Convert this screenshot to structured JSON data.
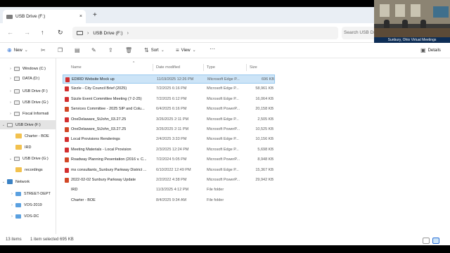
{
  "tab": {
    "title": "USB Drive (F:)",
    "close": "×",
    "new": "+"
  },
  "nav_glyphs": {
    "back": "←",
    "forward": "→",
    "up": "↑",
    "refresh": "↻",
    "more": "···",
    "chevron_right": "›"
  },
  "address": {
    "crumb": "USB Drive (F:)",
    "sep": "›",
    "search_placeholder": "Search USB Dr"
  },
  "toolbar": {
    "new": "New",
    "new_chev": "⌄",
    "sort": "Sort",
    "sort_chev": "⌄",
    "view": "View",
    "view_chev": "⌄",
    "more": "···",
    "details": "Details"
  },
  "sidebar": {
    "items": [
      {
        "label": "Windows (C:)",
        "chev": "›",
        "icon": "drive-icon"
      },
      {
        "label": "DATA (D:)",
        "chev": "›",
        "icon": "drive-icon"
      },
      {
        "label": "USB Drive (F:)",
        "chev": "›",
        "icon": "drive-icon"
      },
      {
        "label": "USB Drive (G:)",
        "chev": "›",
        "icon": "drive-icon"
      },
      {
        "label": "Fiscal Informati",
        "chev": "›",
        "icon": "drive-icon"
      },
      {
        "label": "USB Drive (F:)",
        "chev": "⌄",
        "icon": "drive-icon"
      },
      {
        "label": "Charter - BOE",
        "chev": "",
        "icon": "folder-icon"
      },
      {
        "label": "IRD",
        "chev": "",
        "icon": "folder-icon"
      },
      {
        "label": "USB Drive (G:)",
        "chev": "⌄",
        "icon": "drive-icon"
      },
      {
        "label": "recordings",
        "chev": "",
        "icon": "folder-icon"
      },
      {
        "label": "Network",
        "chev": "⌄",
        "icon": "network-icon"
      },
      {
        "label": "STREET-DEPT",
        "chev": "›",
        "icon": "computer-icon"
      },
      {
        "label": "VOS-2019",
        "chev": "›",
        "icon": "computer-icon"
      },
      {
        "label": "VOS-DC",
        "chev": "›",
        "icon": "computer-icon"
      }
    ]
  },
  "columns": {
    "name": "Name",
    "date": "Date modified",
    "type": "Type",
    "size": "Size",
    "sort_glyph": "^"
  },
  "files": [
    {
      "name": "EDIRD Website Mock up",
      "date": "11/19/2025 12:26 PM",
      "type": "Microsoft Edge P...",
      "size": "696 KB",
      "kind": "pdf"
    },
    {
      "name": "Sizzle - City Council Brief (2025)",
      "date": "7/2/2025 6:16 PM",
      "type": "Microsoft Edge P...",
      "size": "58,961 KB",
      "kind": "pdf"
    },
    {
      "name": "Sizzle Event Committee Meeting (7-2-25)",
      "date": "7/2/2025 6:12 PM",
      "type": "Microsoft Edge P...",
      "size": "16,064 KB",
      "kind": "pdf"
    },
    {
      "name": "Services Committee - 2025 SIP and Colu...",
      "date": "6/4/2025 6:16 PM",
      "type": "Microsoft PowerP...",
      "size": "20,158 KB",
      "kind": "ppt"
    },
    {
      "name": "OneDelaware_StJohn_03.27.25",
      "date": "3/26/2025 2:11 PM",
      "type": "Microsoft Edge P...",
      "size": "2,505 KB",
      "kind": "pdf"
    },
    {
      "name": "OneDelaware_StJohn_03.27.25",
      "date": "3/26/2025 2:11 PM",
      "type": "Microsoft PowerP...",
      "size": "10,525 KB",
      "kind": "ppt"
    },
    {
      "name": "Local Provisions Renderings",
      "date": "2/4/2025 3:33 PM",
      "type": "Microsoft Edge P...",
      "size": "10,156 KB",
      "kind": "pdf"
    },
    {
      "name": "Meeting Materials - Local Provision",
      "date": "2/3/2025 12:24 PM",
      "type": "Microsoft Edge P...",
      "size": "5,698 KB",
      "kind": "pdf"
    },
    {
      "name": "Roadway Planning Pesentation (2016 v. C...",
      "date": "7/2/2024 5:05 PM",
      "type": "Microsoft PowerP...",
      "size": "8,948 KB",
      "kind": "ppt"
    },
    {
      "name": "ms consultants_Sunbury Parkway District ...",
      "date": "6/10/2022 12:49 PM",
      "type": "Microsoft Edge P...",
      "size": "15,367 KB",
      "kind": "pdf"
    },
    {
      "name": "2022-02-02 Sunbury Parkway Update",
      "date": "2/2/2022 4:38 PM",
      "type": "Microsoft PowerP...",
      "size": "29,942 KB",
      "kind": "ppt"
    },
    {
      "name": "IRD",
      "date": "11/3/2025 4:12 PM",
      "type": "File folder",
      "size": "",
      "kind": "folder"
    },
    {
      "name": "Charter - BOE",
      "date": "8/4/2025 9:34 AM",
      "type": "File folder",
      "size": "",
      "kind": "folder"
    }
  ],
  "status": {
    "count": "13 items",
    "selected": "1 item selected  695 KB"
  },
  "video": {
    "caption": "Sunbury, Ohio  Virtual Meetings"
  },
  "colors": {
    "accent": "#2a6fd6",
    "selection": "#cce4f7",
    "folder": "#f2c14e",
    "pdf": "#d32f2f"
  }
}
